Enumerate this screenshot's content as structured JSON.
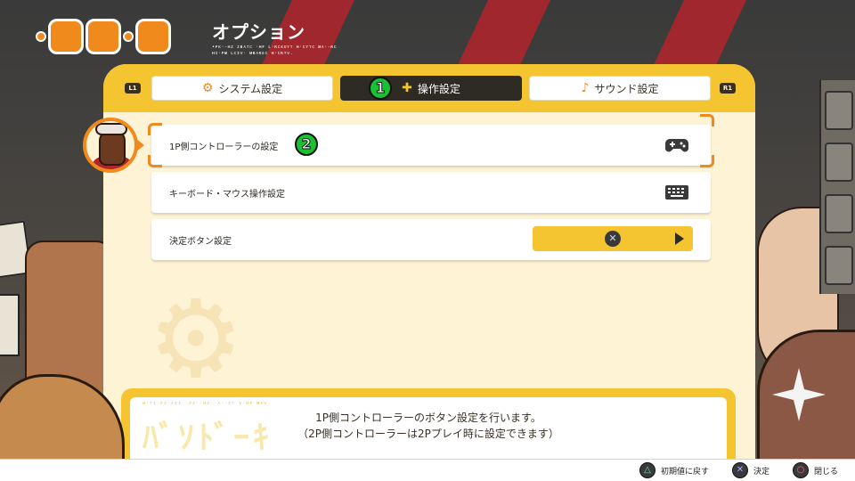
{
  "header": {
    "title": "オプション",
    "subtitle": "•ᴘᴋ·-ʜᴢ ᴢʙᴀᴛᴄ ·ʜғ ʟ·ʀᴄᴋᴏʏᴛ ʜ·ᴄʏᴛᴄ ᴍᴀ·-ʀᴄ ʜɪ·ᴘᴍ ʟᴄɪᴠ· ᴍʙᴀʀᴇᴄ ʜ·ᴄʀᴛᴠ."
  },
  "tabs": {
    "left_shoulder": "L1",
    "right_shoulder": "R1",
    "items": [
      {
        "label": "システム設定",
        "icon": "gear-icon"
      },
      {
        "label": "操作設定",
        "icon": "plus-icon",
        "active": true
      },
      {
        "label": "サウンド設定",
        "icon": "music-note-icon"
      }
    ]
  },
  "annotations": {
    "badge1": "1",
    "badge2": "2"
  },
  "rows": [
    {
      "label": "1P側コントローラーの設定",
      "icon": "gamepad-icon",
      "selected": true
    },
    {
      "label": "キーボード・マウス操作設定",
      "icon": "keyboard-icon"
    },
    {
      "label": "決定ボタン設定",
      "value_symbol": "✕"
    }
  ],
  "description": {
    "tiny": "ʜ·ᴛɪ·ᴘᴢ ᴀɪɪ ·ᴘᴢ·-ʜᴢ ·ᴀ-·ᴢᴛ ᴠ·ʜғ ᴍᴀᴠ",
    "decor": "ﾊﾞｿﾄﾞｰｷ",
    "line1": "1P側コントローラーのボタン設定を行います。",
    "line2": "（2P側コントローラーは2Pプレイ時に設定できます）"
  },
  "footer": {
    "hints": [
      {
        "symbol": "△",
        "label": "初期値に戻す"
      },
      {
        "symbol": "✕",
        "label": "決定"
      },
      {
        "symbol": "○",
        "label": "閉じる"
      }
    ]
  },
  "colors": {
    "accent": "#f5c531",
    "highlight": "#f08a1c",
    "badge": "#19c233",
    "active_tab": "#2e2a24"
  }
}
